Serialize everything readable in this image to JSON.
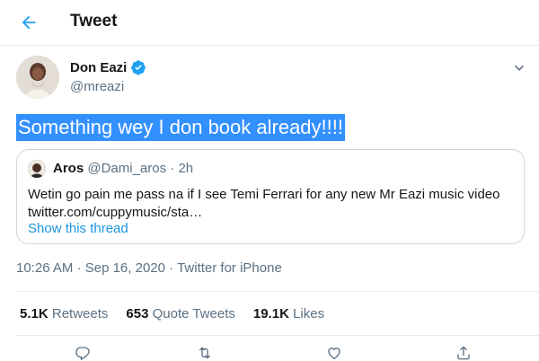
{
  "header": {
    "title": "Tweet",
    "back_icon": "arrow-left-icon",
    "accent": "#1da1f2"
  },
  "author": {
    "name": "Don Eazi",
    "handle": "@mreazi",
    "verified_icon": "verified-badge-icon"
  },
  "tweet": {
    "text": "Something wey I don book already!!!!"
  },
  "quote": {
    "name": "Aros",
    "handle": "@Dami_aros",
    "separator": "·",
    "time": "2h",
    "body": "Wetin go pain me pass na if I see Temi Ferrari for any new Mr Eazi music video",
    "link": "twitter.com/cuppymusic/sta…",
    "thread_label": "Show this thread"
  },
  "meta": {
    "time": "10:26 AM",
    "separator": "·",
    "date": "Sep 16, 2020",
    "source": "Twitter for iPhone"
  },
  "stats": [
    {
      "count": "5.1K",
      "label": "Retweets"
    },
    {
      "count": "653",
      "label": "Quote Tweets"
    },
    {
      "count": "19.1K",
      "label": "Likes"
    }
  ],
  "actions": [
    "reply-icon",
    "retweet-icon",
    "like-icon",
    "share-icon"
  ]
}
